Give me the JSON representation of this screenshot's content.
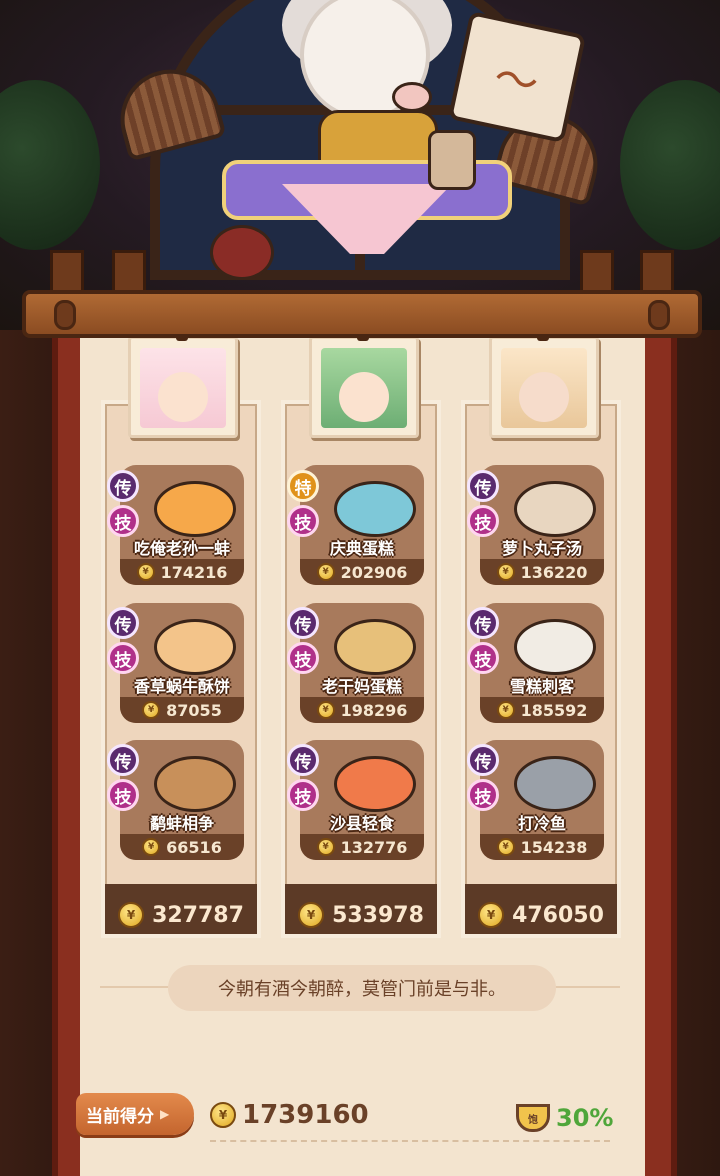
{
  "columns": [
    {
      "total": "327787",
      "dishes": [
        {
          "name": "吃俺老孙一蚌",
          "score": "174216",
          "badges": [
            "传",
            "技"
          ]
        },
        {
          "name": "香草蜗牛酥饼",
          "score": "87055",
          "badges": [
            "传",
            "技"
          ]
        },
        {
          "name": "鹬蚌相争",
          "score": "66516",
          "badges": [
            "传",
            "技"
          ]
        }
      ]
    },
    {
      "total": "533978",
      "dishes": [
        {
          "name": "庆典蛋糕",
          "score": "202906",
          "badges": [
            "特",
            "技"
          ]
        },
        {
          "name": "老干妈蛋糕",
          "score": "198296",
          "badges": [
            "传",
            "技"
          ]
        },
        {
          "name": "沙县轻食",
          "score": "132776",
          "badges": [
            "传",
            "技"
          ]
        }
      ]
    },
    {
      "total": "476050",
      "dishes": [
        {
          "name": "萝卜丸子汤",
          "score": "136220",
          "badges": [
            "传",
            "技"
          ]
        },
        {
          "name": "雪糕刺客",
          "score": "185592",
          "badges": [
            "传",
            "技"
          ]
        },
        {
          "name": "打冷鱼",
          "score": "154238",
          "badges": [
            "传",
            "技"
          ]
        }
      ]
    }
  ],
  "quote": "今朝有酒今朝醉，莫管门前是与非。",
  "score": {
    "label": "当前得分",
    "value": "1739160"
  },
  "bonus": "30%",
  "icons": {
    "coin": "coin-icon",
    "bowl": "bonus-bowl-icon",
    "arrow": "play-arrow-icon"
  },
  "colors": {
    "legend_badge": "#5a2a6e",
    "special_badge": "#e0921a",
    "skill_badge": "#b0308a",
    "bonus_text": "#4fa63a"
  }
}
